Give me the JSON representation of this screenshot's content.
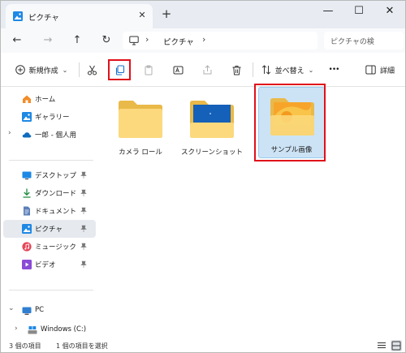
{
  "window": {
    "tab_title": "ピクチャ",
    "tab_close": "✕",
    "new_tab": "+",
    "minimize": "—",
    "maximize": "☐",
    "close": "✕"
  },
  "address": {
    "back": "←",
    "forward": "→",
    "up": "↑",
    "refresh": "↻",
    "separator": "›",
    "path": "ピクチャ",
    "search_placeholder": "ピクチャの検"
  },
  "toolbar": {
    "new_label": "新規作成",
    "sort_label": "並べ替え",
    "more_label": "•••",
    "details_label": "詳細",
    "caret": "⌄"
  },
  "sidebar": {
    "items": [
      {
        "label": "ホーム",
        "icon": "home-icon"
      },
      {
        "label": "ギャラリー",
        "icon": "gallery-icon"
      },
      {
        "label": "一郎 - 個人用",
        "icon": "cloud-icon"
      },
      {
        "label": "デスクトップ",
        "icon": "desktop-icon"
      },
      {
        "label": "ダウンロード",
        "icon": "download-icon"
      },
      {
        "label": "ドキュメント",
        "icon": "document-icon"
      },
      {
        "label": "ピクチャ",
        "icon": "pictures-icon"
      },
      {
        "label": "ミュージック",
        "icon": "music-icon"
      },
      {
        "label": "ビデオ",
        "icon": "video-icon"
      },
      {
        "label": "PC",
        "icon": "pc-icon"
      },
      {
        "label": "Windows (C:)",
        "icon": "drive-icon"
      }
    ],
    "chevron_right": "›",
    "chevron_down": "⌄"
  },
  "content": {
    "folders": [
      {
        "name": "カメラ ロール",
        "type": "plain"
      },
      {
        "name": "スクリーンショット",
        "type": "screenshot"
      },
      {
        "name": "サンプル画像",
        "type": "sample"
      }
    ]
  },
  "status": {
    "item_count": "3 個の項目",
    "selection": "1 個の項目を選択"
  },
  "colors": {
    "accent": "#0067c0",
    "highlight": "#e0101a",
    "folder": "#f8d775",
    "selected": "#cce3f5"
  }
}
